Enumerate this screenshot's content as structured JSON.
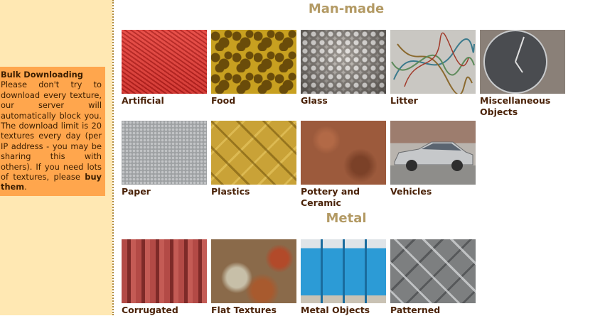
{
  "sidebar": {
    "notice_title": "Bulk Downloading",
    "notice_text": "Please don't try to download every texture, our server will automatically block you. The download limit is 20 textures every day (per IP address - you may be sharing this with others). If you need lots of textures, please ",
    "notice_link": "buy them",
    "notice_end": "."
  },
  "sections": [
    {
      "title": "Man-made",
      "items": [
        {
          "label": "Artificial",
          "icon": "red-textured-surface"
        },
        {
          "label": "Food",
          "icon": "yellow-noodle-texture"
        },
        {
          "label": "Glass",
          "icon": "dimpled-glass"
        },
        {
          "label": "Litter",
          "icon": "tangled-wires"
        },
        {
          "label": "Miscellaneous Objects",
          "icon": "wall-clock"
        },
        {
          "label": "Paper",
          "icon": "gray-dotted-paper"
        },
        {
          "label": "Plastics",
          "icon": "yellow-treadplate"
        },
        {
          "label": "Pottery and Ceramic",
          "icon": "rusty-terracotta"
        },
        {
          "label": "Vehicles",
          "icon": "silver-car"
        }
      ]
    },
    {
      "title": "Metal",
      "items": [
        {
          "label": "Corrugated",
          "icon": "red-corrugated-metal"
        },
        {
          "label": "Flat Textures",
          "icon": "rusted-flat-metal"
        },
        {
          "label": "Metal Objects",
          "icon": "blue-container"
        },
        {
          "label": "Patterned",
          "icon": "steel-treadplate"
        }
      ]
    }
  ],
  "colors": {
    "sidebar_bg": "#ffe8b3",
    "notice_bg": "#ffa64d",
    "heading": "#b39a64",
    "caption": "#4a2208"
  }
}
